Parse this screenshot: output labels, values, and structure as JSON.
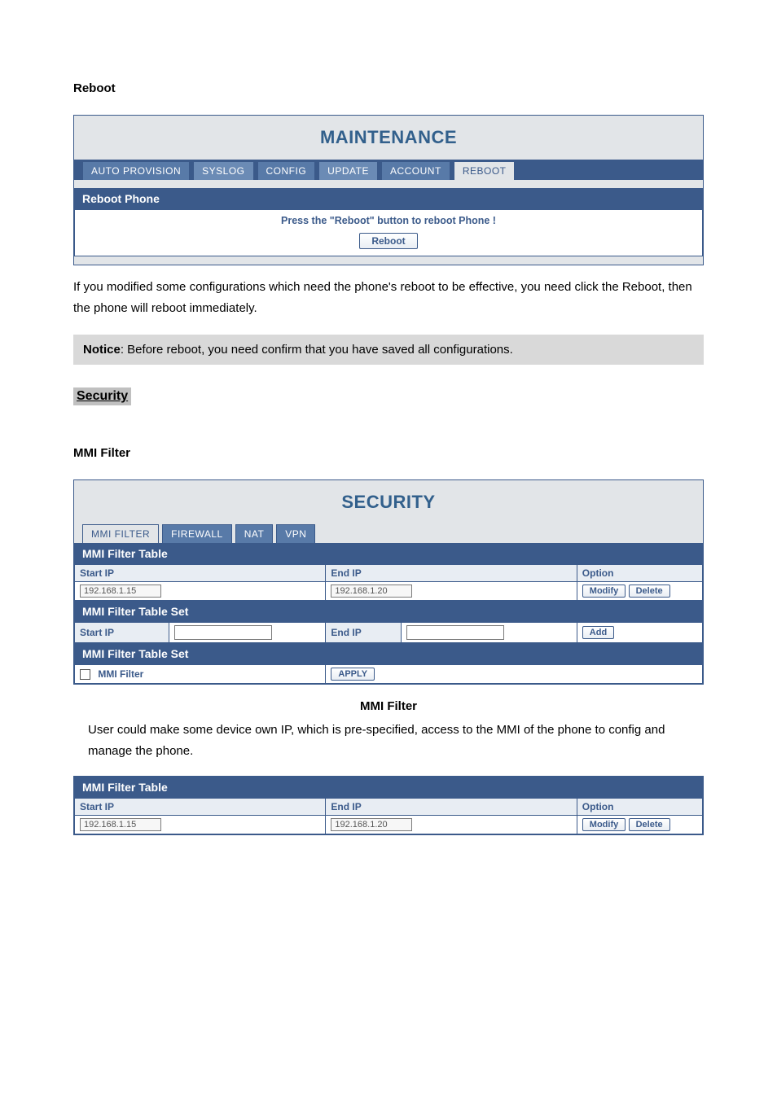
{
  "sections": {
    "rebootHeading": "Reboot",
    "mmiFilterHeading": "MMI Filter"
  },
  "maintenance": {
    "title": "MAINTENANCE",
    "tabs": [
      "AUTO PROVISION",
      "SYSLOG",
      "CONFIG",
      "UPDATE",
      "ACCOUNT",
      "REBOOT"
    ],
    "activeTab": "REBOOT",
    "rebootBar": "Reboot Phone",
    "instruction": "Press the \"Reboot\" button to reboot Phone !",
    "rebootBtn": "Reboot"
  },
  "afterRebootPara": "If you modified some configurations which need the phone's reboot to be effective, you need click the Reboot, then the phone will reboot immediately.",
  "notice": {
    "label": "Notice",
    "text": ": Before reboot, you need confirm that you have saved all configurations."
  },
  "securityHeading": "Security",
  "security": {
    "title": "SECURITY",
    "tabs": [
      "MMI FILTER",
      "FIREWALL",
      "NAT",
      "VPN"
    ],
    "activeTab": "MMI FILTER",
    "filterTable": {
      "bar": "MMI Filter Table",
      "headers": {
        "start": "Start IP",
        "end": "End IP",
        "option": "Option"
      },
      "rows": [
        {
          "start": "192.168.1.15",
          "end": "192.168.1.20"
        }
      ],
      "modify": "Modify",
      "delete": "Delete"
    },
    "filterSet": {
      "bar": "MMI Filter Table Set",
      "startLabel": "Start IP",
      "endLabel": "End IP",
      "addBtn": "Add"
    },
    "filterEnable": {
      "bar": "MMI Filter Table Set",
      "checkboxLabel": "MMI Filter",
      "applyBtn": "APPLY"
    }
  },
  "mmiDesc": {
    "title": "MMI Filter",
    "text": "User could make some device own IP, which is pre-specified, access to the MMI of the phone to config and manage the phone."
  },
  "mmiTable2": {
    "bar": "MMI Filter Table",
    "headers": {
      "start": "Start IP",
      "end": "End IP",
      "option": "Option"
    },
    "rows": [
      {
        "start": "192.168.1.15",
        "end": "192.168.1.20"
      }
    ],
    "modify": "Modify",
    "delete": "Delete"
  }
}
